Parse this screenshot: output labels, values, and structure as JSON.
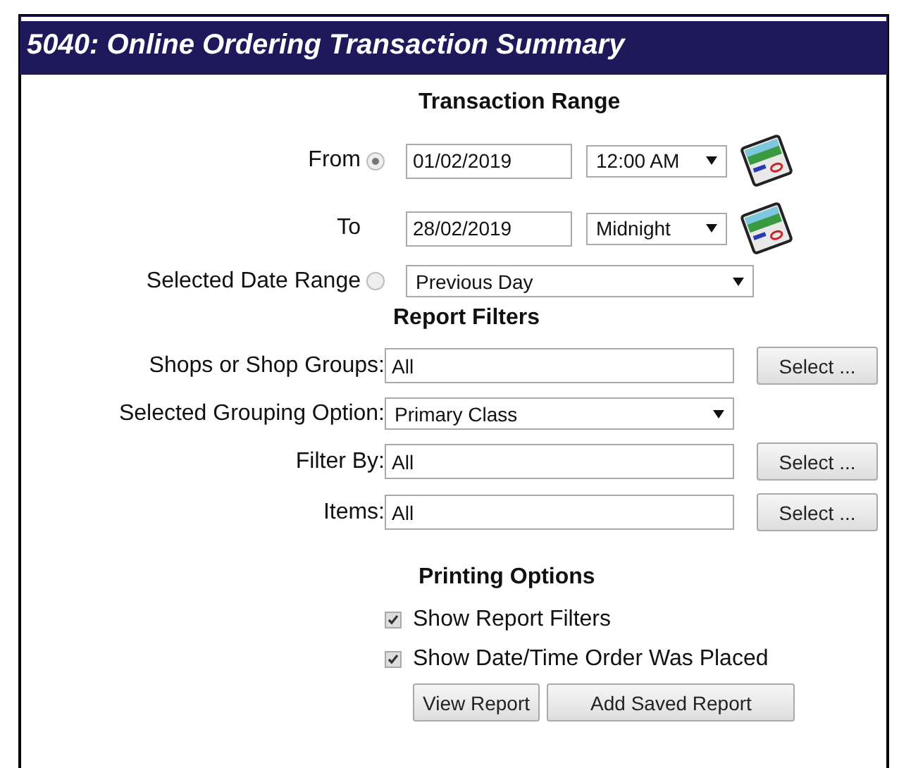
{
  "window": {
    "title": "5040: Online Ordering Transaction Summary"
  },
  "transaction_range": {
    "heading": "Transaction Range",
    "rows": [
      {
        "kind": "radio-date",
        "label": "From",
        "selected": true,
        "date": "01/02/2019",
        "time": "12:00 AM"
      },
      {
        "kind": "date",
        "label": "To",
        "date": "28/02/2019",
        "time": "Midnight"
      },
      {
        "kind": "radio-select",
        "label": "Selected Date Range",
        "selected": false,
        "value": "Previous Day"
      }
    ]
  },
  "report_filters": {
    "heading": "Report Filters",
    "rows": [
      {
        "kind": "text",
        "label": "Shops or Shop Groups:",
        "value": "All",
        "button": "Select ..."
      },
      {
        "kind": "select",
        "label": "Selected Grouping Option:",
        "value": "Primary Class"
      },
      {
        "kind": "text",
        "label": "Filter By:",
        "value": "All",
        "button": "Select ..."
      },
      {
        "kind": "text",
        "label": "Items:",
        "value": "All",
        "button": "Select ..."
      }
    ]
  },
  "printing_options": {
    "heading": "Printing Options",
    "options": [
      {
        "label": "Show Report Filters",
        "checked": true
      },
      {
        "label": "Show Date/Time Order Was Placed",
        "checked": true
      }
    ],
    "buttons": [
      "View Report",
      "Add Saved Report"
    ]
  }
}
